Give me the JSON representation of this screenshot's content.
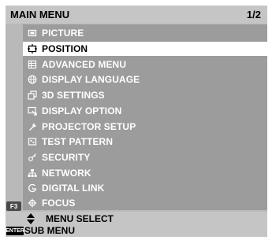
{
  "header": {
    "title": "MAIN MENU",
    "page": "1/2"
  },
  "menu": {
    "items": [
      {
        "label": "PICTURE",
        "icon": "picture-icon"
      },
      {
        "label": "POSITION",
        "icon": "position-icon",
        "selected": true
      },
      {
        "label": "ADVANCED MENU",
        "icon": "advanced-menu-icon"
      },
      {
        "label": "DISPLAY LANGUAGE",
        "icon": "globe-icon"
      },
      {
        "label": "3D SETTINGS",
        "icon": "3d-settings-icon"
      },
      {
        "label": "DISPLAY OPTION",
        "icon": "display-option-icon"
      },
      {
        "label": "PROJECTOR SETUP",
        "icon": "wrench-icon"
      },
      {
        "label": "TEST PATTERN",
        "icon": "test-pattern-icon"
      },
      {
        "label": "SECURITY",
        "icon": "key-icon"
      },
      {
        "label": "NETWORK",
        "icon": "network-icon"
      },
      {
        "label": "DIGITAL LINK",
        "icon": "digital-link-icon"
      },
      {
        "label": "FOCUS",
        "icon": "focus-icon"
      }
    ],
    "function_key": "F3"
  },
  "footer": {
    "select_label": "MENU SELECT",
    "enter_key": "ENTER",
    "enter_label": "SUB MENU"
  },
  "colors": {
    "panel": "#b9b9b9",
    "header": "#c5c5c5",
    "menu_background": "#9c9c9c",
    "selected_background": "#ffffff",
    "item_text": "#ffffff"
  }
}
